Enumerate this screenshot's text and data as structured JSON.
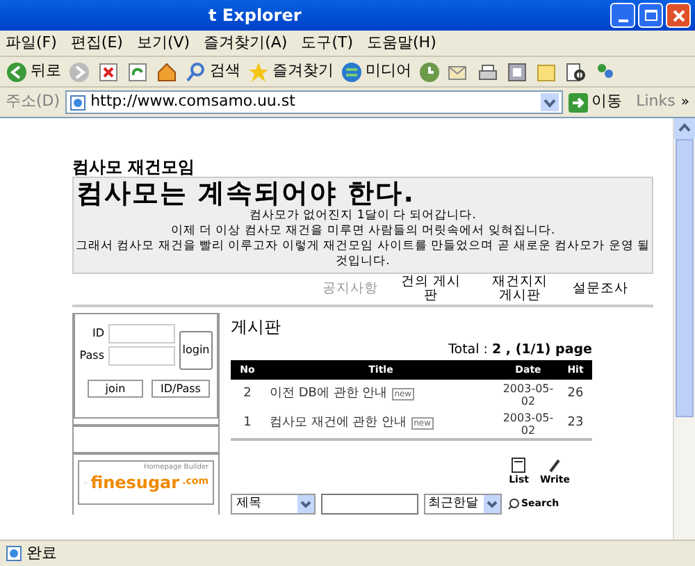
{
  "window": {
    "title": "t Explorer"
  },
  "menu": [
    "파일(F)",
    "편집(E)",
    "보기(V)",
    "즐겨찾기(A)",
    "도구(T)",
    "도움말(H)"
  ],
  "toolbar": [
    {
      "kind": "back",
      "label": "뒤로"
    },
    {
      "kind": "forward"
    },
    {
      "kind": "stop"
    },
    {
      "kind": "refresh"
    },
    {
      "kind": "home"
    },
    {
      "kind": "search",
      "label": "검색"
    },
    {
      "kind": "favorites",
      "label": "즐겨찾기"
    },
    {
      "kind": "media",
      "label": "미디어"
    },
    {
      "kind": "history"
    },
    {
      "kind": "mail"
    },
    {
      "kind": "print"
    },
    {
      "kind": "edit"
    },
    {
      "kind": "note"
    },
    {
      "kind": "research"
    },
    {
      "kind": "messenger"
    }
  ],
  "address_bar": {
    "label": "주소(D)",
    "url": "http://www.comsamo.uu.st",
    "go": "이동",
    "links": "Links",
    "more": "»"
  },
  "page": {
    "site_title": "컴사모 재건모임",
    "heading": "컴사모는 계속되어야 한다.",
    "intro": [
      "컴사모가 없어진지 1달이 다 되어갑니다.",
      "이제 더 이상 컴사모 재건을 미루면 사람들의 머릿속에서 잊혀집니다.",
      "그래서 컴사모 재건을 빨리 이루고자 이렇게 재건모임 사이트를 만들었으며 곧 새로운 컴사모가 운영 될 것입니다."
    ],
    "nav": [
      {
        "label": "공지사항",
        "selected": true
      },
      {
        "label": "건의 게시판",
        "selected": false
      },
      {
        "label": "재건지지 게시판",
        "selected": false
      },
      {
        "label": "설문조사",
        "selected": false
      }
    ],
    "login": {
      "id_label": "ID",
      "pass_label": "Pass",
      "login_button": "login",
      "join_button": "join",
      "find_button": "ID/Pass"
    },
    "banner": {
      "tagline": "Homepage Builder",
      "name": "finesugar",
      "suffix": ".com"
    },
    "board": {
      "title": "게시판",
      "total": "Total : **2 , (1/1) page**",
      "columns": [
        "No",
        "Title",
        "Date",
        "Hit"
      ],
      "rows": [
        {
          "no": "2",
          "title": "이전 DB에 관한 안내",
          "badge": "new",
          "date": "2003-05-02",
          "hit": "26"
        },
        {
          "no": "1",
          "title": "컴사모 재건에 관한 안내",
          "badge": "new",
          "date": "2003-05-02",
          "hit": "23"
        }
      ],
      "list_button": "List",
      "write_button": "Write",
      "search_field": "제목",
      "period": "최근한달",
      "search_button": "Search"
    }
  },
  "status_bar": {
    "text": "완료"
  }
}
